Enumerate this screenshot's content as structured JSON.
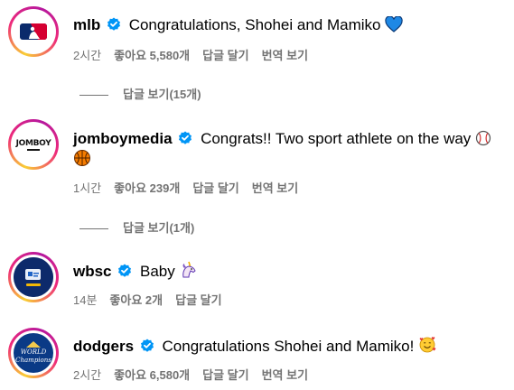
{
  "comments": [
    {
      "username": "mlb",
      "text": "Congratulations, Shohei and Mamiko",
      "emoji": "blue-heart",
      "time": "2시간",
      "likes": "좋아요 5,580개",
      "reply": "답글 달기",
      "translate": "번역 보기",
      "view_replies": "답글 보기(15개)"
    },
    {
      "username": "jomboymedia",
      "text": "Congrats!! Two sport athlete on the way",
      "emoji": "baseball, basketball",
      "avatar_text": "JOMBOY",
      "time": "1시간",
      "likes": "좋아요 239개",
      "reply": "답글 달기",
      "translate": "번역 보기",
      "view_replies": "답글 보기(1개)"
    },
    {
      "username": "wbsc",
      "text": "Baby",
      "emoji": "unicorn",
      "time": "14분",
      "likes": "좋아요 2개",
      "reply": "답글 달기"
    },
    {
      "username": "dodgers",
      "text": "Congratulations Shohei and Mamiko!",
      "emoji": "smiling-face-with-hearts",
      "avatar_text": "WORLD Champions",
      "time": "2시간",
      "likes": "좋아요 6,580개",
      "reply": "답글 달기",
      "translate": "번역 보기"
    }
  ],
  "colors": {
    "verified": "#0095f6",
    "meta": "#737373"
  }
}
